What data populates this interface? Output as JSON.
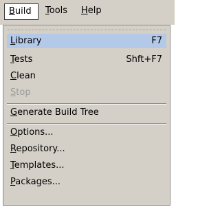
{
  "menubar": {
    "items": [
      {
        "first": "B",
        "rest": "uild"
      },
      {
        "first": "T",
        "rest": "ools"
      },
      {
        "first": "H",
        "rest": "elp"
      }
    ]
  },
  "menu": {
    "items": [
      {
        "first": "L",
        "rest": "ibrary",
        "shortcut": "F7"
      },
      {
        "first": "T",
        "rest": "ests",
        "shortcut": "Shft+F7"
      },
      {
        "first": "C",
        "rest": "lean"
      },
      {
        "first": "S",
        "rest": "top"
      },
      {
        "first": "G",
        "rest": "enerate Build Tree"
      },
      {
        "first": "O",
        "rest": "ptions..."
      },
      {
        "first": "R",
        "rest": "epository..."
      },
      {
        "first": "T",
        "rest": "emplates..."
      },
      {
        "first": "P",
        "rest": "ackages..."
      }
    ]
  }
}
